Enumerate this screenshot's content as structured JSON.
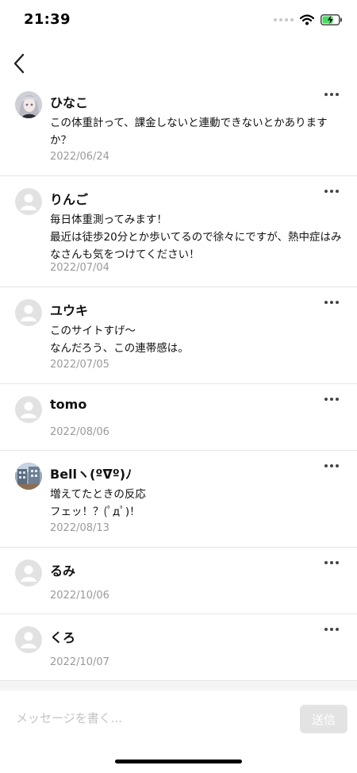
{
  "status": {
    "time": "21:39"
  },
  "icons": {
    "back": "chevron-left-icon",
    "more": "more-horizontal-icon",
    "wifi": "wifi-icon",
    "battery": "battery-charging-icon"
  },
  "colors": {
    "battery_fill": "#4cd964",
    "send_disabled": "#e3e3e3",
    "date_text": "#9a9a9a"
  },
  "comments": [
    {
      "author": "ひなこ",
      "body": "この体重計って、課金しないと連動できないとかありますか？",
      "date": "2022/06/24",
      "avatar": "photo-girl"
    },
    {
      "author": "りんご",
      "body": "毎日体重測ってみます！\n最近は徒歩20分とか歩いてるので徐々にですが、熱中症はみなさんも気をつけてください！",
      "date": "2022/07/04",
      "avatar": "default"
    },
    {
      "author": "ユウキ",
      "body": "このサイトすげ〜\nなんだろう、この連帯感は。",
      "date": "2022/07/05",
      "avatar": "default"
    },
    {
      "author": "tomo",
      "body": "",
      "date": "2022/08/06",
      "avatar": "default"
    },
    {
      "author": "Bellヽ(ºᐁº)ﾉ",
      "body": "増えてたときの反応\nフェッ！？(ﾟдﾟ)！",
      "date": "2022/08/13",
      "avatar": "photo-building"
    },
    {
      "author": "るみ",
      "body": "",
      "date": "2022/10/06",
      "avatar": "default"
    },
    {
      "author": "くろ",
      "body": "",
      "date": "2022/10/07",
      "avatar": "default"
    }
  ],
  "composer": {
    "placeholder": "メッセージを書く...",
    "send_label": "送信"
  }
}
